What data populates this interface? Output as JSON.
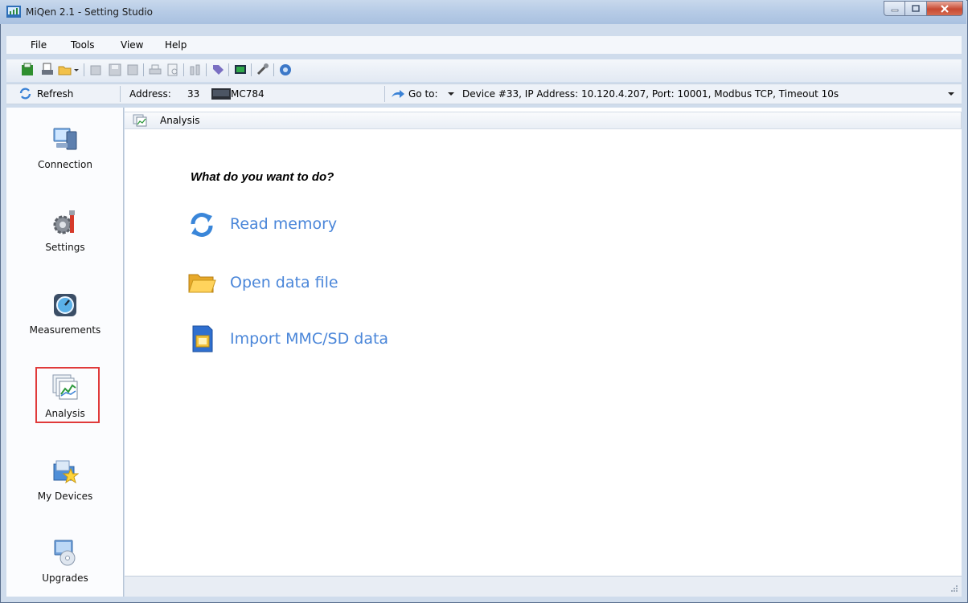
{
  "window": {
    "title": "MiQen 2.1 - Setting Studio"
  },
  "menu": [
    {
      "label": "File"
    },
    {
      "label": "Tools"
    },
    {
      "label": "View"
    },
    {
      "label": "Help"
    }
  ],
  "addressbar": {
    "refresh_label": "Refresh",
    "address_label": "Address:",
    "address_value": "33",
    "device_model": "MC784",
    "goto_label": "Go to:",
    "connection_info": "Device #33, IP Address: 10.120.4.207, Port: 10001, Modbus TCP, Timeout 10s"
  },
  "sidebar": {
    "items": [
      {
        "label": "Connection",
        "icon": "computer-icon"
      },
      {
        "label": "Settings",
        "icon": "settings-gear-icon"
      },
      {
        "label": "Measurements",
        "icon": "gauge-icon"
      },
      {
        "label": "Analysis",
        "icon": "analysis-chart-icon",
        "selected": true
      },
      {
        "label": "My Devices",
        "icon": "folder-star-icon"
      },
      {
        "label": "Upgrades",
        "icon": "upgrade-cd-icon"
      }
    ]
  },
  "breadcrumb": {
    "label": "Analysis"
  },
  "main": {
    "question": "What do you want to do?",
    "actions": [
      {
        "label": "Read memory",
        "icon": "refresh-arrows-icon"
      },
      {
        "label": "Open data file",
        "icon": "folder-icon"
      },
      {
        "label": "Import MMC/SD data",
        "icon": "sd-card-icon"
      }
    ]
  },
  "colors": {
    "accent_link": "#4a86d9",
    "selection_border": "#e03a3a"
  }
}
